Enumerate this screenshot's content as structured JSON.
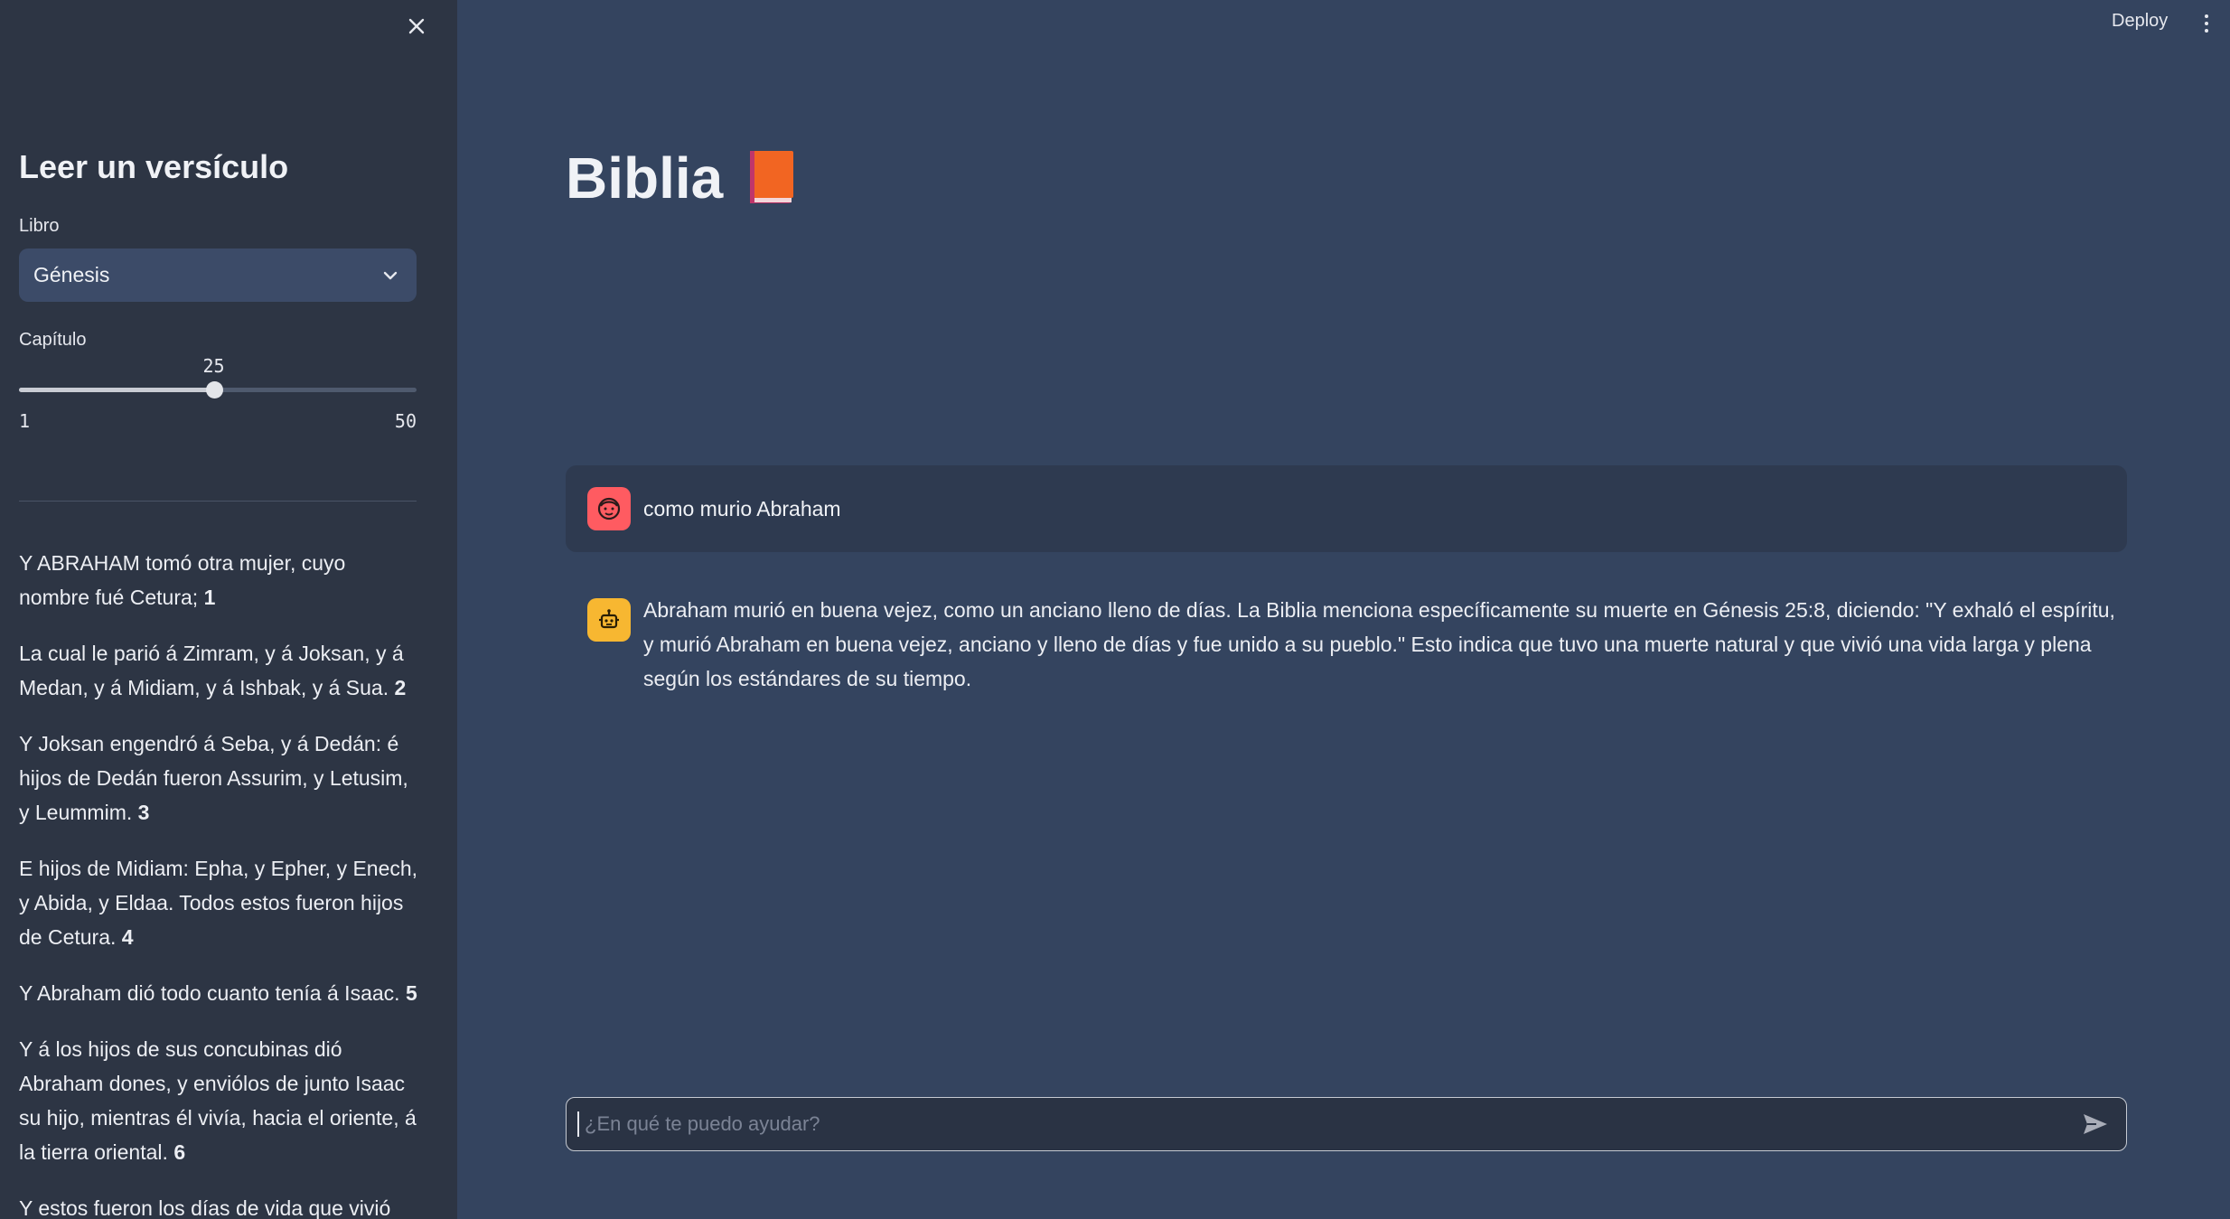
{
  "sidebar": {
    "title": "Leer un versículo",
    "book_label": "Libro",
    "book_selected": "Génesis",
    "chapter_label": "Capítulo",
    "chapter": {
      "value": "25",
      "min": "1",
      "max": "50",
      "fraction": 0.4898
    },
    "verses": [
      {
        "text": "Y ABRAHAM tomó otra mujer, cuyo nombre fué Cetura;",
        "num": "1"
      },
      {
        "text": "La cual le parió á Zimram, y á Joksan, y á Medan, y á Midiam, y á Ishbak, y á Sua.",
        "num": "2"
      },
      {
        "text": "Y Joksan engendró á Seba, y á Dedán: é hijos de Dedán fueron Assurim, y Letusim, y Leummim.",
        "num": "3"
      },
      {
        "text": "E hijos de Midiam: Epha, y Epher, y Enech, y Abida, y Eldaa. Todos estos fueron hijos de Cetura.",
        "num": "4"
      },
      {
        "text": "Y Abraham dió todo cuanto tenía á Isaac.",
        "num": "5"
      },
      {
        "text": "Y á los hijos de sus concubinas dió Abraham dones, y enviólos de junto Isaac su hijo, mientras él vivía, hacia el oriente, á la tierra oriental.",
        "num": "6"
      },
      {
        "text": "Y estos fueron los días de vida que vivió",
        "num": ""
      }
    ]
  },
  "header": {
    "deploy_label": "Deploy"
  },
  "main": {
    "title": "Biblia"
  },
  "chat": {
    "messages": [
      {
        "role": "user",
        "text": "como murio Abraham"
      },
      {
        "role": "assistant",
        "text": "Abraham murió en buena vejez, como un anciano lleno de días. La Biblia menciona específicamente su muerte en Génesis 25:8, diciendo: \"Y exhaló el espíritu, y murió Abraham en buena vejez, anciano y lleno de días y fue unido a su pueblo.\" Esto indica que tuvo una muerte natural y que vivió una vida larga y plena según los estándares de su tiempo."
      }
    ],
    "input_placeholder": "¿En qué te puedo ayudar?",
    "input_value": ""
  },
  "colors": {
    "main_bg": "#34445f",
    "sidebar_bg": "#2d3544",
    "user_avatar": "#ff5b61",
    "bot_avatar": "#f7b731",
    "book_icon": "#f26522"
  },
  "icons": {
    "close": "close-icon",
    "chevron": "chevron-down-icon",
    "book": "orange-book-icon",
    "user_avatar": "face-icon",
    "bot_avatar": "robot-icon",
    "send": "send-icon",
    "menu": "vertical-dots-icon"
  }
}
